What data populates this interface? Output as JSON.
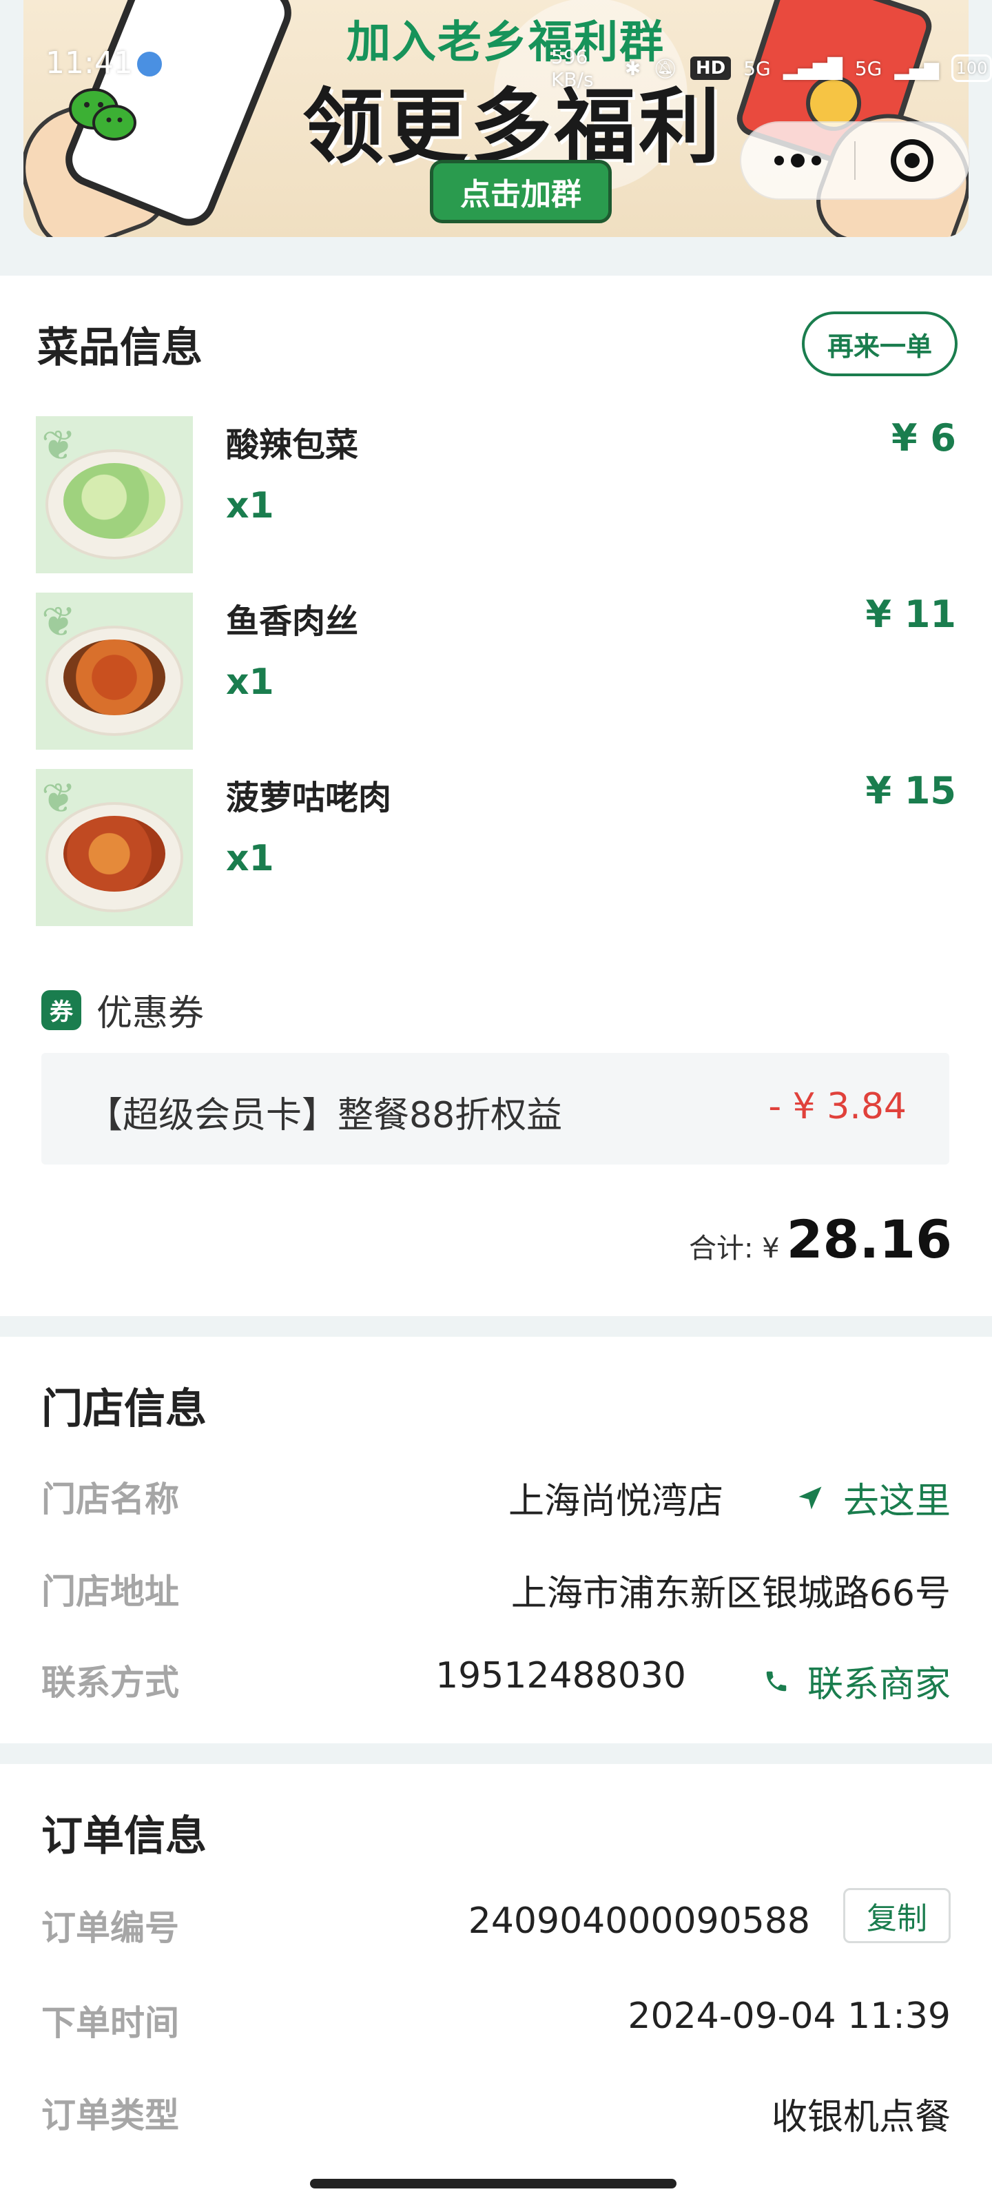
{
  "status_bar": {
    "time": "11:41",
    "net_speed": "596 KB/s",
    "hd": "HD",
    "signal_1": "5G",
    "signal_2": "5G",
    "battery": "100"
  },
  "banner": {
    "line1": "加入老乡福利群",
    "line2": "领更多福利",
    "button": "点击加群"
  },
  "dishes": {
    "title": "菜品信息",
    "reorder_label": "再来一单",
    "items": [
      {
        "name": "酸辣包菜",
        "qty": "x1",
        "price": "¥ 6"
      },
      {
        "name": "鱼香肉丝",
        "qty": "x1",
        "price": "¥ 11"
      },
      {
        "name": "菠萝咕咾肉",
        "qty": "x1",
        "price": "¥ 15"
      }
    ]
  },
  "coupon": {
    "badge": "券",
    "label": "优惠券",
    "name": "【超级会员卡】整餐88折权益",
    "amount": "- ¥ 3.84"
  },
  "total": {
    "label": "合计: ¥",
    "value": "28.16"
  },
  "store": {
    "title": "门店信息",
    "name_key": "门店名称",
    "name_val": "上海尚悦湾店",
    "nav_label": "去这里",
    "address_key": "门店地址",
    "address_val": "上海市浦东新区银城路66号",
    "contact_key": "联系方式",
    "contact_val": "19512488030",
    "contact_action": "联系商家"
  },
  "order": {
    "title": "订单信息",
    "number_key": "订单编号",
    "number_val": "240904000090588",
    "copy_label": "复制",
    "time_key": "下单时间",
    "time_val": "2024-09-04 11:39",
    "type_key": "订单类型",
    "type_val": "收银机点餐"
  },
  "colors": {
    "accent_green": "#1a7d4e",
    "discount_red": "#e0413b",
    "page_bg": "#eef3f4"
  }
}
